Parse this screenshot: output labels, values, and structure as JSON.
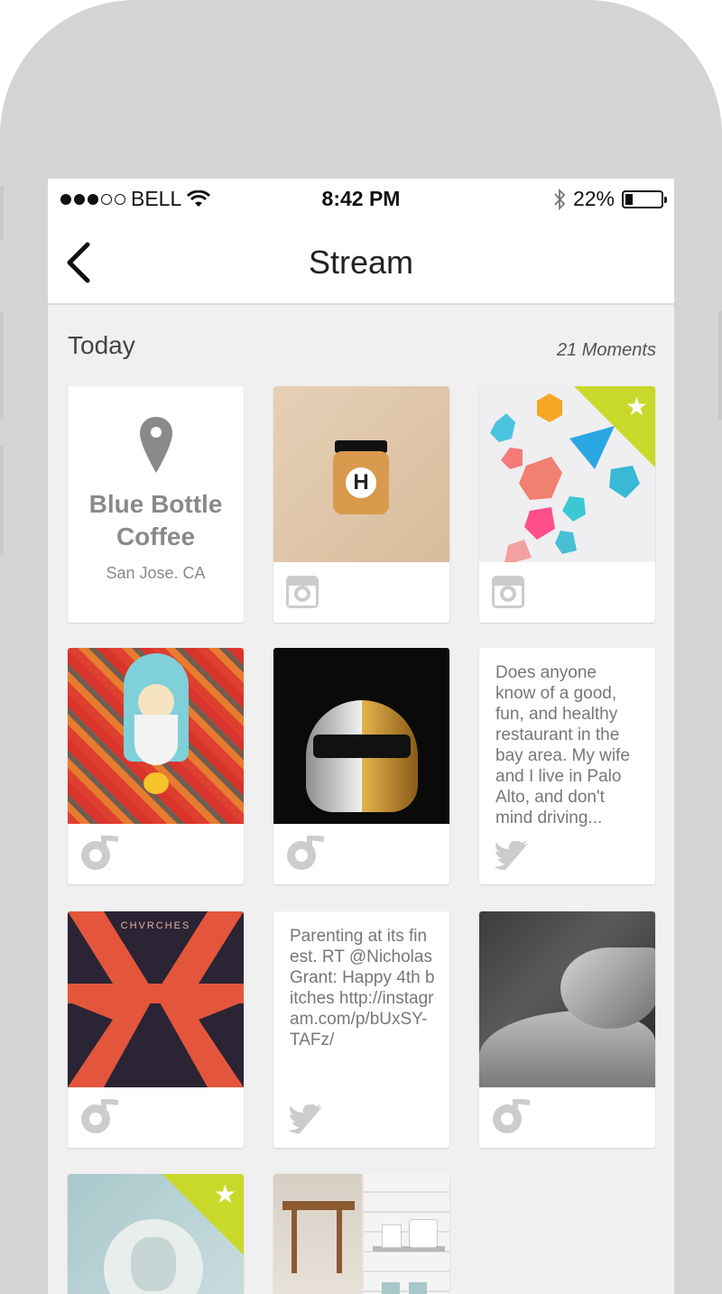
{
  "status_bar": {
    "carrier": "BELL",
    "time": "8:42 PM",
    "battery": "22%",
    "battery_level": 0.22
  },
  "nav": {
    "title": "Stream",
    "back_icon": "chevron-left-icon"
  },
  "section": {
    "title": "Today",
    "count": "21 Moments"
  },
  "cards": {
    "place": {
      "name_line1": "Blue Bottle",
      "name_line2": "Coffee",
      "location": "San Jose. CA",
      "icon": "map-pin-icon"
    },
    "tweet1": {
      "text": "Does anyone know of a good, fun, and healthy restaurant in the bay area. My wife and I live in Palo Alto, and don't mind driving...",
      "icon": "twitter-icon"
    },
    "tweet2": {
      "text": "Parenting at its finest. RT @NicholasGrant: Happy 4th bitches http://instagram.com/p/bUxSY-TAFz/",
      "icon": "twitter-icon"
    },
    "chvrches_label": "CHVRCHES"
  },
  "colors": {
    "accent_ribbon": "#c9d92a",
    "icon_gray": "#cccccc",
    "screen_bg": "#f0f0f0"
  }
}
